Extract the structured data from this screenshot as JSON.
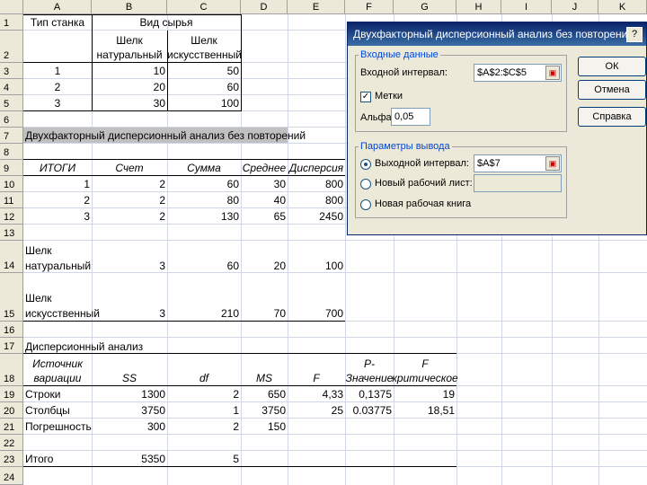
{
  "columns": [
    "A",
    "B",
    "C",
    "D",
    "E",
    "F",
    "G",
    "H",
    "I",
    "J",
    "K"
  ],
  "rows": [
    "1",
    "2",
    "3",
    "4",
    "5",
    "6",
    "7",
    "8",
    "9",
    "10",
    "11",
    "12",
    "13",
    "14",
    "15",
    "16",
    "17",
    "18",
    "19",
    "20",
    "21",
    "22",
    "23",
    "24"
  ],
  "sheet": {
    "a1": "Тип станка",
    "b1": "Вид сырья",
    "b2a": "Шелк",
    "b2b": "натуральный",
    "c2a": "Шелк",
    "c2b": "искусственный",
    "t1": {
      "a3": "1",
      "b3": "10",
      "c3": "50",
      "a4": "2",
      "b4": "20",
      "c4": "60",
      "a5": "3",
      "b5": "30",
      "c5": "100"
    },
    "title7": "Двухфакторный дисперсионный анализ без повторений",
    "h9": [
      "ИТОГИ",
      "Счет",
      "Сумма",
      "Среднее",
      "Дисперсия"
    ],
    "r10": [
      "1",
      "2",
      "60",
      "30",
      "800"
    ],
    "r11": [
      "2",
      "2",
      "80",
      "40",
      "800"
    ],
    "r12": [
      "3",
      "2",
      "130",
      "65",
      "2450"
    ],
    "r14": [
      "Шелк",
      "натуральный",
      "3",
      "60",
      "20",
      "100"
    ],
    "r15": [
      "Шелк",
      "искусственный",
      "3",
      "210",
      "70",
      "700"
    ],
    "title17": "Дисперсионный анализ",
    "h18": [
      "Источник",
      "вариации",
      "SS",
      "df",
      "MS",
      "F",
      "P-",
      "Значение",
      "F",
      "критическое"
    ],
    "r19": [
      "Строки",
      "1300",
      "2",
      "650",
      "4,33",
      "0,1375",
      "19"
    ],
    "r20": [
      "Столбцы",
      "3750",
      "1",
      "3750",
      "25",
      "0.03775",
      "18,51"
    ],
    "r21": [
      "Погрешность",
      "300",
      "2",
      "150"
    ],
    "r23": [
      "Итого",
      "5350",
      "5"
    ]
  },
  "dialog": {
    "title": "Двухфакторный дисперсионный анализ без повторений",
    "help": "?",
    "input_group": "Входные данные",
    "input_range_label": "Входной интервал:",
    "input_range_value": "$A$2:$C$5",
    "labels_checkbox": "Метки",
    "labels_checked": true,
    "alpha_label": "Альфа:",
    "alpha_value": "0,05",
    "output_group": "Параметры вывода",
    "out_range_label": "Выходной интервал:",
    "out_range_value": "$A$7",
    "new_sheet_label": "Новый рабочий лист:",
    "new_book_label": "Новая рабочая книга",
    "ok": "ОК",
    "cancel": "Отмена",
    "help_btn": "Справка"
  }
}
